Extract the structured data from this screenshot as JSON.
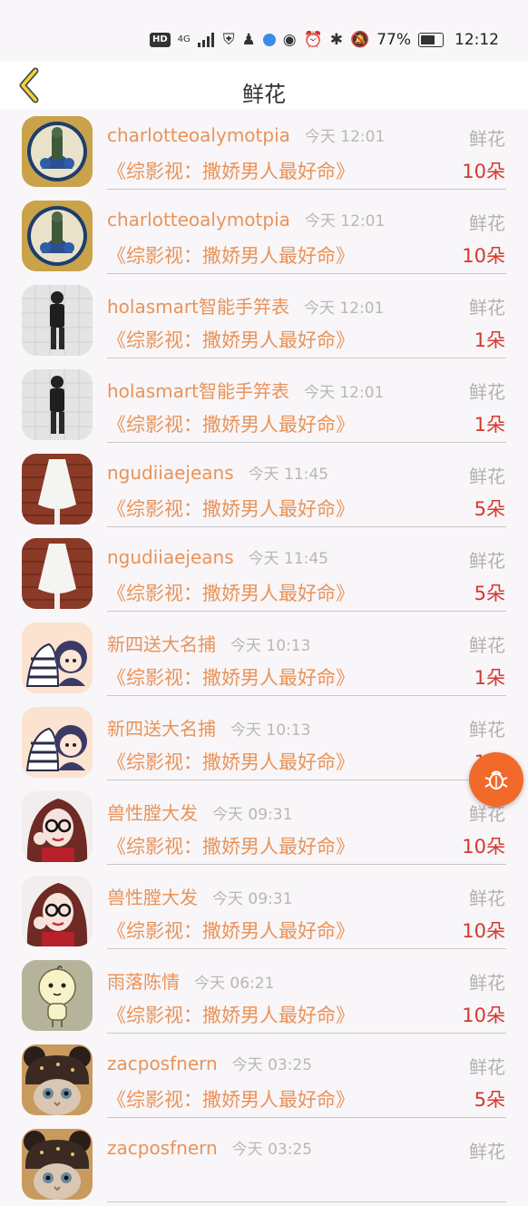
{
  "status_bar": {
    "hd": "HD",
    "network": "4G",
    "battery": "77%",
    "battery_level": 0.77,
    "time": "12:12"
  },
  "header": {
    "title": "鲜花",
    "back_icon": "chevron-left-icon"
  },
  "colors": {
    "name": "#e9935a",
    "time": "#b9b6b8",
    "quantity": "#d5382f",
    "fab": "#f26a2a"
  },
  "gifts": [
    {
      "user": "charlotteoalymotpia",
      "time": "今天 12:01",
      "type": "鲜花",
      "book": "《综影视：撒娇男人最好命》",
      "quantity": "10朵",
      "avatar": "crest-avatar"
    },
    {
      "user": "charlotteoalymotpia",
      "time": "今天 12:01",
      "type": "鲜花",
      "book": "《综影视：撒娇男人最好命》",
      "quantity": "10朵",
      "avatar": "crest-avatar"
    },
    {
      "user": "holasmart智能手笄表",
      "time": "今天 12:01",
      "type": "鲜花",
      "book": "《综影视：撒娇男人最好命》",
      "quantity": "1朵",
      "avatar": "photo-avatar"
    },
    {
      "user": "holasmart智能手笄表",
      "time": "今天 12:01",
      "type": "鲜花",
      "book": "《综影视：撒娇男人最好命》",
      "quantity": "1朵",
      "avatar": "photo-avatar"
    },
    {
      "user": "ngudiiaejeans",
      "time": "今天 11:45",
      "type": "鲜花",
      "book": "《综影视：撒娇男人最好命》",
      "quantity": "5朵",
      "avatar": "lamp-avatar"
    },
    {
      "user": "ngudiiaejeans",
      "time": "今天 11:45",
      "type": "鲜花",
      "book": "《综影视：撒娇男人最好命》",
      "quantity": "5朵",
      "avatar": "lamp-avatar"
    },
    {
      "user": "新四送大名捕",
      "time": "今天 10:13",
      "type": "鲜花",
      "book": "《综影视：撒娇男人最好命》",
      "quantity": "1朵",
      "avatar": "cartoon-avatar"
    },
    {
      "user": "新四送大名捕",
      "time": "今天 10:13",
      "type": "鲜花",
      "book": "《综影视：撒娇男人最好命》",
      "quantity": "1朵",
      "avatar": "cartoon-avatar"
    },
    {
      "user": "兽性膛大发",
      "time": "今天 09:31",
      "type": "鲜花",
      "book": "《综影视：撒娇男人最好命》",
      "quantity": "10朵",
      "avatar": "girl-avatar"
    },
    {
      "user": "兽性膛大发",
      "time": "今天 09:31",
      "type": "鲜花",
      "book": "《综影视：撒娇男人最好命》",
      "quantity": "10朵",
      "avatar": "girl-avatar"
    },
    {
      "user": "雨落陈情",
      "time": "今天 06:21",
      "type": "鲜花",
      "book": "《综影视：撒娇男人最好命》",
      "quantity": "10朵",
      "avatar": "doll-avatar"
    },
    {
      "user": "zacposfnern",
      "time": "今天 03:25",
      "type": "鲜花",
      "book": "《综影视：撒娇男人最好命》",
      "quantity": "5朵",
      "avatar": "cat-avatar"
    },
    {
      "user": "zacposfnern",
      "time": "今天 03:25",
      "type": "鲜花",
      "book": "",
      "quantity": "",
      "avatar": "cat-avatar"
    }
  ],
  "fab": {
    "icon": "bug-icon"
  }
}
